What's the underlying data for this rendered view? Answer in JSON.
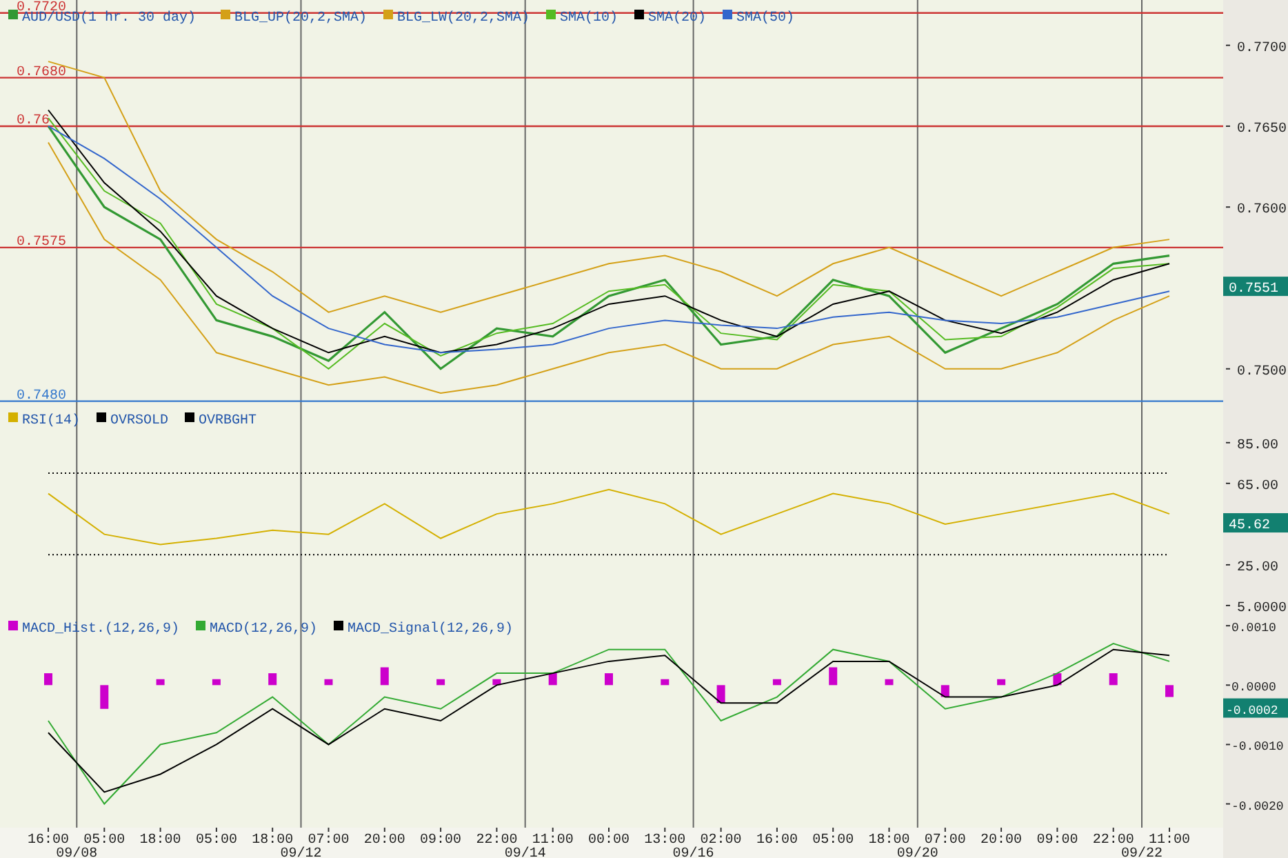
{
  "price_panel": {
    "last_value": "0.7551",
    "chart_data": {
      "type": "line",
      "legend": "upper left",
      "ylim": [
        0.7479,
        0.7728
      ],
      "yticks": [
        {
          "value": 0.77,
          "label": "0.7700"
        },
        {
          "value": 0.765,
          "label": "0.7650"
        },
        {
          "value": 0.76,
          "label": "0.7600"
        },
        {
          "value": 0.75,
          "label": "0.7500"
        }
      ],
      "series": [
        {
          "name": "AUD/USD(1 hr.  30 day)",
          "color": "#339933",
          "values": [
            0.765,
            0.76,
            0.758,
            0.753,
            0.752,
            0.7505,
            0.7535,
            0.75,
            0.7525,
            0.752,
            0.7545,
            0.7555,
            0.7515,
            0.752,
            0.7555,
            0.7545,
            0.751,
            0.7525,
            0.754,
            0.7565,
            0.757
          ]
        },
        {
          "name": "BLG_UP(20,2,SMA)",
          "color": "#d4a017",
          "values": [
            0.769,
            0.768,
            0.761,
            0.758,
            0.756,
            0.7535,
            0.7545,
            0.7535,
            0.7545,
            0.7555,
            0.7565,
            0.757,
            0.756,
            0.7545,
            0.7565,
            0.7575,
            0.756,
            0.7545,
            0.756,
            0.7575,
            0.758
          ]
        },
        {
          "name": "BLG_LW(20,2,SMA)",
          "color": "#d4a017",
          "values": [
            0.764,
            0.758,
            0.7555,
            0.751,
            0.75,
            0.749,
            0.7495,
            0.7485,
            0.749,
            0.75,
            0.751,
            0.7515,
            0.75,
            0.75,
            0.7515,
            0.752,
            0.75,
            0.75,
            0.751,
            0.753,
            0.7545
          ]
        },
        {
          "name": "SMA(10)",
          "color": "#55bb22",
          "values": [
            0.7655,
            0.761,
            0.759,
            0.754,
            0.7525,
            0.75,
            0.7528,
            0.7508,
            0.7522,
            0.7528,
            0.7548,
            0.7552,
            0.7522,
            0.7518,
            0.7552,
            0.7548,
            0.7518,
            0.752,
            0.7538,
            0.7562,
            0.7565
          ]
        },
        {
          "name": "SMA(20)",
          "color": "#000000",
          "values": [
            0.766,
            0.7615,
            0.7585,
            0.7545,
            0.7525,
            0.751,
            0.752,
            0.751,
            0.7515,
            0.7525,
            0.754,
            0.7545,
            0.753,
            0.752,
            0.754,
            0.7548,
            0.753,
            0.7522,
            0.7535,
            0.7555,
            0.7565
          ]
        },
        {
          "name": "SMA(50)",
          "color": "#3366cc",
          "values": [
            0.765,
            0.763,
            0.7605,
            0.7575,
            0.7545,
            0.7525,
            0.7515,
            0.751,
            0.7512,
            0.7515,
            0.7525,
            0.753,
            0.7527,
            0.7525,
            0.7532,
            0.7535,
            0.753,
            0.7528,
            0.7532,
            0.754,
            0.7548
          ]
        }
      ],
      "ref_lines": [
        {
          "axis": "y",
          "value": 0.772,
          "label": "0.7720",
          "color": "#cc3333"
        },
        {
          "axis": "y",
          "value": 0.768,
          "label": "0.7680",
          "color": "#cc3333"
        },
        {
          "axis": "y",
          "value": 0.765,
          "label": "0.76",
          "color": "#cc3333"
        },
        {
          "axis": "y",
          "value": 0.7575,
          "label": "0.7575",
          "color": "#cc3333"
        },
        {
          "axis": "y",
          "value": 0.748,
          "label": "0.7480",
          "color": "#3377cc"
        }
      ]
    }
  },
  "rsi_panel": {
    "last_value": "45.62",
    "chart_data": {
      "type": "line",
      "legend": "upper left",
      "ylim": [
        0.9,
        104.6
      ],
      "yticks": [
        {
          "value": 85,
          "label": "85.00"
        },
        {
          "value": 65,
          "label": "65.00"
        },
        {
          "value": 25,
          "label": "25.00"
        },
        {
          "value": 5,
          "label": "5.0000"
        }
      ],
      "series": [
        {
          "name": "RSI(14)",
          "color": "#d4b000",
          "values": [
            60,
            40,
            35,
            38,
            42,
            40,
            55,
            38,
            50,
            55,
            62,
            55,
            40,
            50,
            60,
            55,
            45,
            50,
            55,
            60,
            50
          ]
        },
        {
          "name": "OVRSOLD",
          "color": "#000000",
          "line_style": "dotted",
          "values": [
            30,
            30,
            30,
            30,
            30,
            30,
            30,
            30,
            30,
            30,
            30,
            30,
            30,
            30,
            30,
            30,
            30,
            30,
            30,
            30,
            30
          ]
        },
        {
          "name": "OVRBGHT",
          "color": "#000000",
          "line_style": "dotted",
          "values": [
            70,
            70,
            70,
            70,
            70,
            70,
            70,
            70,
            70,
            70,
            70,
            70,
            70,
            70,
            70,
            70,
            70,
            70,
            70,
            70,
            70
          ]
        }
      ]
    }
  },
  "macd_panel": {
    "last_value": "-0.0002",
    "chart_data": {
      "type": "line",
      "legend": "upper left",
      "ylim": [
        -0.0024,
        0.0012
      ],
      "categories": [
        "16:00",
        "05:00",
        "18:00",
        "05:00",
        "18:00",
        "07:00",
        "20:00",
        "09:00",
        "22:00",
        "11:00",
        "00:00",
        "13:00",
        "02:00",
        "16:00",
        "05:00",
        "18:00",
        "07:00",
        "20:00",
        "09:00",
        "22:00",
        "11:00"
      ],
      "yticks": [
        {
          "value": 0.001,
          "label": "0.0010"
        },
        {
          "value": 0,
          "label": "0.0000"
        },
        {
          "value": -0.001,
          "label": "-0.0010"
        },
        {
          "value": -0.002,
          "label": "-0.0020"
        }
      ],
      "series": [
        {
          "name": "MACD_Hist.(12,26,9)",
          "type": "bar",
          "color": "#cc00cc",
          "values": [
            0.0002,
            -0.0004,
            0.0001,
            0.0001,
            0.0002,
            0.0001,
            0.0003,
            0.0001,
            0.0001,
            0.0002,
            0.0002,
            0.0001,
            -0.0003,
            0.0001,
            0.0003,
            0.0001,
            -0.0002,
            0.0001,
            0.0002,
            0.0002,
            -0.0002
          ]
        },
        {
          "name": "MACD(12,26,9)",
          "color": "#33aa33",
          "values": [
            -0.0006,
            -0.002,
            -0.001,
            -0.0008,
            -0.0002,
            -0.001,
            -0.0002,
            -0.0004,
            0.0002,
            0.0002,
            0.0006,
            0.0006,
            -0.0006,
            -0.0002,
            0.0006,
            0.0004,
            -0.0004,
            -0.0002,
            0.0002,
            0.0007,
            0.0004
          ]
        },
        {
          "name": "MACD_Signal(12,26,9)",
          "color": "#000000",
          "values": [
            -0.0008,
            -0.0018,
            -0.0015,
            -0.001,
            -0.0004,
            -0.001,
            -0.0004,
            -0.0006,
            0.0,
            0.0002,
            0.0004,
            0.0005,
            -0.0003,
            -0.0003,
            0.0004,
            0.0004,
            -0.0002,
            -0.0002,
            0.0,
            0.0006,
            0.0005
          ]
        }
      ]
    }
  },
  "date_labels": [
    "09/08",
    "09/12",
    "09/14",
    "09/16",
    "09/20",
    "09/22"
  ]
}
